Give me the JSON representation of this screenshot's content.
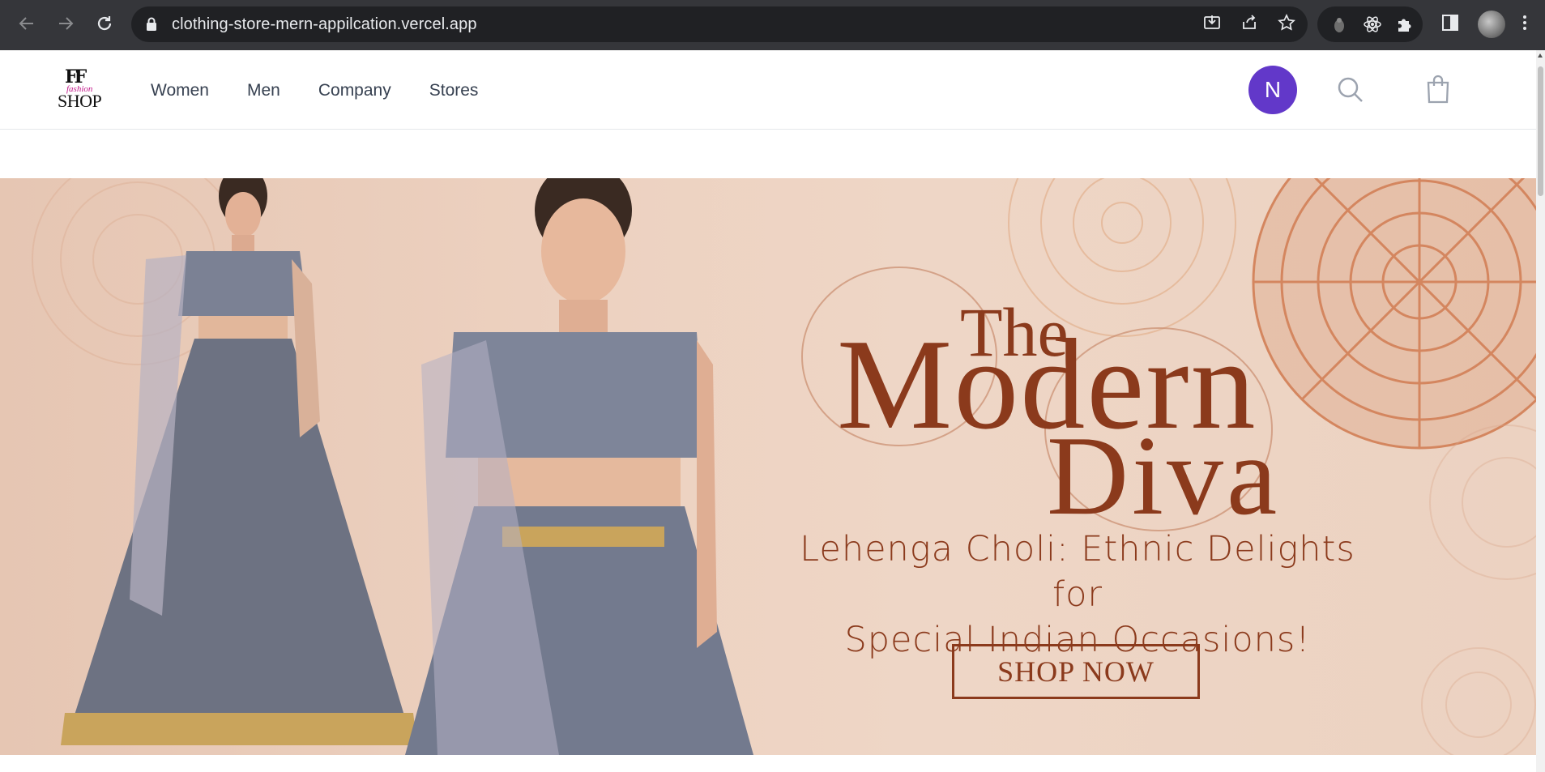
{
  "browser": {
    "url": "clothing-store-mern-appilcation.vercel.app",
    "icons": [
      "back-icon",
      "forward-icon",
      "reload-icon",
      "lock-icon",
      "install-icon",
      "share-icon",
      "star-icon",
      "extension-ghost-icon",
      "react-devtools-icon",
      "puzzle-icon",
      "side-panel-icon",
      "profile-avatar",
      "kebab-menu-icon"
    ]
  },
  "header": {
    "logo": {
      "mark": "FF",
      "script_text": "fashion",
      "wordmark": "SHOP"
    },
    "nav": [
      {
        "label": "Women"
      },
      {
        "label": "Men"
      },
      {
        "label": "Company"
      },
      {
        "label": "Stores"
      }
    ],
    "user_initial": "N",
    "icons": [
      "search-icon",
      "shopping-bag-icon"
    ]
  },
  "hero": {
    "headline_the": "The",
    "headline_modern": "Modern",
    "headline_diva": "Diva",
    "subline_1": "Lehenga Choli: Ethnic Delights for",
    "subline_2": "Special Indian Occasions!",
    "cta_label": "SHOP NOW",
    "colors": {
      "text": "#8b3a1c",
      "background": "#ecd2c1",
      "mandala": "#d4865f"
    }
  }
}
